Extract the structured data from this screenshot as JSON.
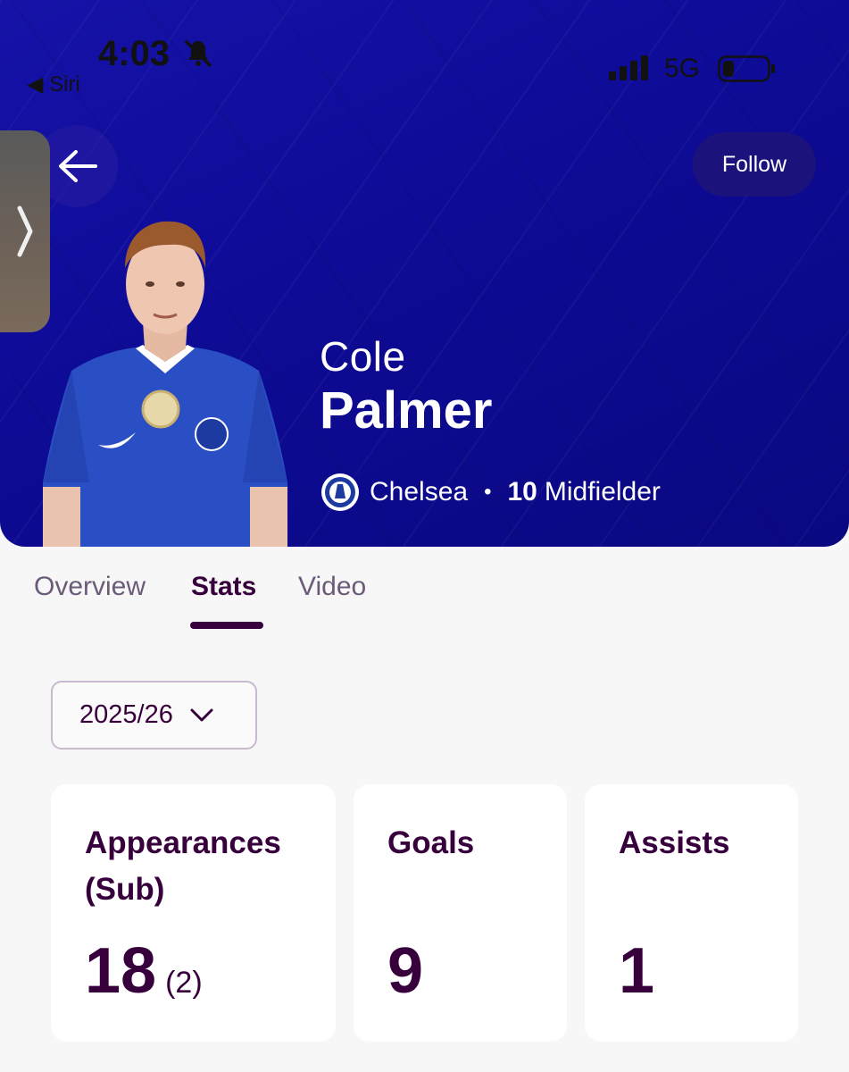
{
  "status_bar": {
    "time": "4:03",
    "back_app": "◀ Siri",
    "network": "5G"
  },
  "header": {
    "follow_label": "Follow"
  },
  "player": {
    "first_name": "Cole",
    "last_name": "Palmer",
    "club": "Chelsea",
    "separator": "•",
    "shirt_number": "10",
    "position": "Midfielder"
  },
  "tabs": [
    {
      "label": "Overview",
      "active": false
    },
    {
      "label": "Stats",
      "active": true
    },
    {
      "label": "Video",
      "active": false
    }
  ],
  "season_select": {
    "value": "2025/26"
  },
  "stats": [
    {
      "label": "Appearances (Sub)",
      "value": "18",
      "sub": "(2)"
    },
    {
      "label": "Goals",
      "value": "9"
    },
    {
      "label": "Assists",
      "value": "1"
    }
  ],
  "colors": {
    "hero_blue": "#0e0b96",
    "text_purple": "#37003c",
    "page_bg": "#f7f7f7"
  }
}
